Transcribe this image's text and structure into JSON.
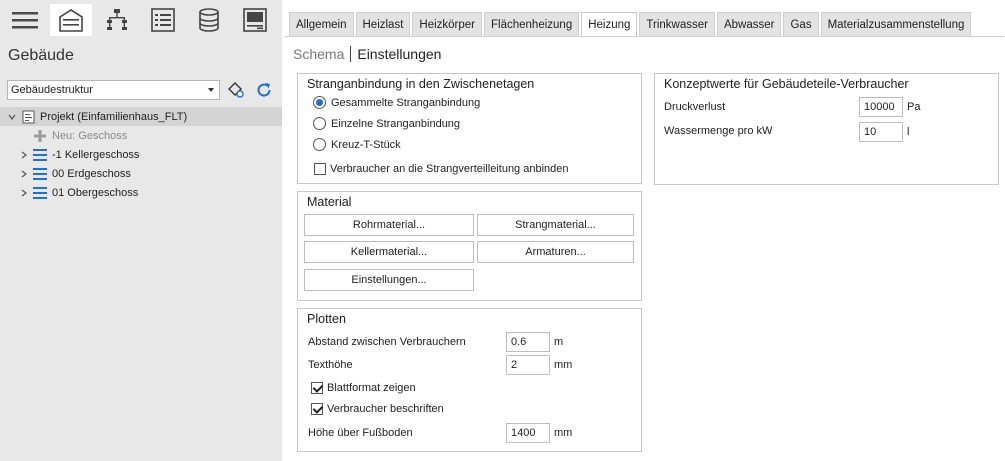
{
  "toolbar": {
    "items": [
      {
        "icon": "menu-icon"
      },
      {
        "icon": "building-icon"
      },
      {
        "icon": "network-tree-icon"
      },
      {
        "icon": "list-icon"
      },
      {
        "icon": "database-icon"
      },
      {
        "icon": "sheet-icon"
      }
    ]
  },
  "left": {
    "title": "Gebäude",
    "select_value": "Gebäudestruktur",
    "tree": [
      {
        "label": "Projekt (Einfamilienhaus_FLT)",
        "icon": "project-icon"
      },
      {
        "label": "Neu: Geschoss",
        "icon": "plus-icon"
      },
      {
        "label": "-1 Kellergeschoss",
        "icon": "floor-icon"
      },
      {
        "label": "00 Erdgeschoss",
        "icon": "floor-icon"
      },
      {
        "label": "01 Obergeschoss",
        "icon": "floor-icon"
      }
    ]
  },
  "tabs": [
    {
      "label": "Allgemein"
    },
    {
      "label": "Heizlast"
    },
    {
      "label": "Heizkörper"
    },
    {
      "label": "Flächenheizung"
    },
    {
      "label": "Heizung",
      "active": true
    },
    {
      "label": "Trinkwasser"
    },
    {
      "label": "Abwasser"
    },
    {
      "label": "Gas"
    },
    {
      "label": "Materialzusammenstellung"
    }
  ],
  "subnav": {
    "schema": "Schema",
    "settings": "Einstellungen"
  },
  "strang": {
    "title": "Stranganbindung in den Zwischenetagen",
    "options": [
      {
        "label": "Gesammelte Stranganbindung",
        "selected": true
      },
      {
        "label": "Einzelne Stranganbindung",
        "selected": false
      },
      {
        "label": "Kreuz-T-Stück",
        "selected": false
      }
    ],
    "checkbox": {
      "label": "Verbraucher an die Strangverteilleitung anbinden",
      "checked": false
    }
  },
  "material": {
    "title": "Material",
    "buttons": {
      "rohr": "Rohrmaterial...",
      "strang": "Strangmaterial...",
      "keller": "Kellermaterial...",
      "armaturen": "Armaturen...",
      "einstellungen": "Einstellungen..."
    }
  },
  "plotten": {
    "title": "Plotten",
    "abstand": {
      "label": "Abstand zwischen Verbrauchern",
      "value": "0.6",
      "unit": "m"
    },
    "texthoehe": {
      "label": "Texthöhe",
      "value": "2",
      "unit": "mm"
    },
    "blattformat": {
      "label": "Blattformat zeigen",
      "checked": true
    },
    "beschriften": {
      "label": "Verbraucher beschriften",
      "checked": true
    },
    "hoehe": {
      "label": "Höhe über Fußboden",
      "value": "1400",
      "unit": "mm"
    }
  },
  "konzept": {
    "title": "Konzeptwerte für Gebäudeteile-Verbraucher",
    "druck": {
      "label": "Druckverlust",
      "value": "10000",
      "unit": "Pa"
    },
    "wasser": {
      "label": "Wassermenge pro kW",
      "value": "10",
      "unit": "l"
    }
  },
  "colors": {
    "accent": "#1e6fd9",
    "panel": "#e8e8e8"
  }
}
